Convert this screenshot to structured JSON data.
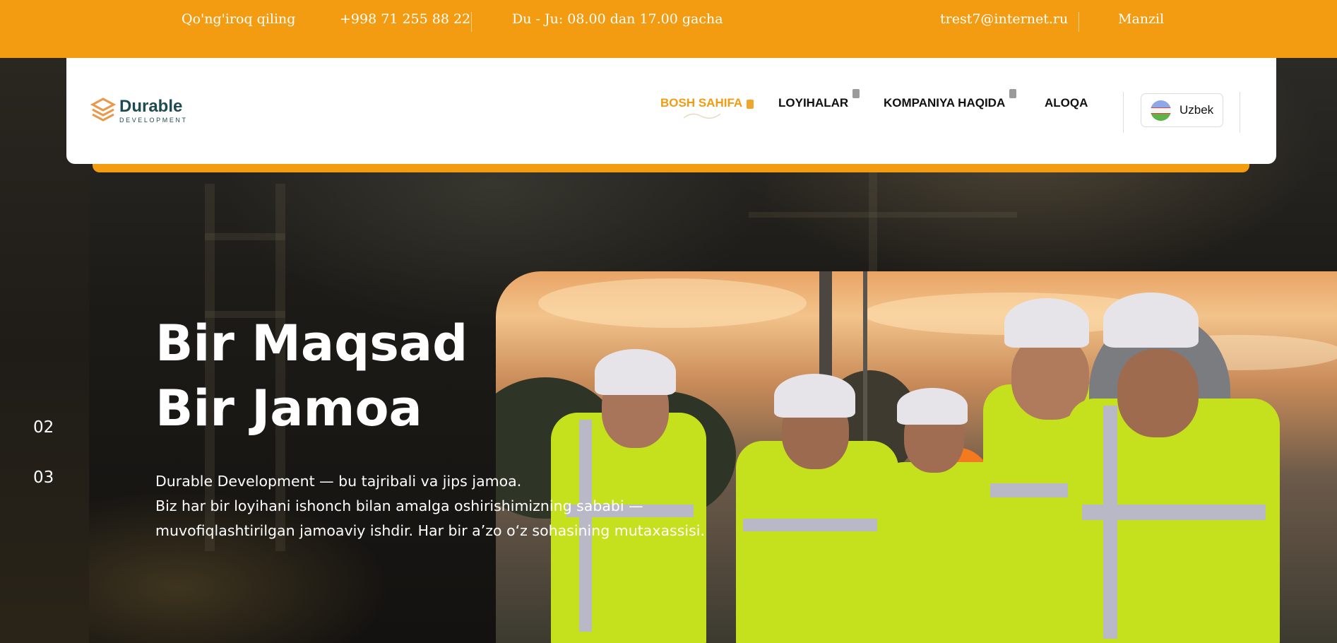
{
  "topbar": {
    "call_label": "Qo'ng'iroq qiling",
    "phone": "+998 71 255 88 22",
    "hours": "Du - Ju: 08.00 dan 17.00 gacha",
    "email": "trest7@internet.ru",
    "address_label": "Manzil",
    "bg_color": "#f39c12"
  },
  "logo": {
    "name": "Durable",
    "tagline": "DEVELOPMENT",
    "icon": "layers-logo-icon"
  },
  "nav": {
    "items": [
      {
        "label": "BOSH SAHIFA",
        "active": true
      },
      {
        "label": "LOYIHALAR",
        "active": false
      },
      {
        "label": "KOMPANIYA HAQIDA",
        "active": false
      },
      {
        "label": "ALOQA",
        "active": false
      }
    ],
    "accent_color": "#f39c12"
  },
  "language": {
    "selected": "Uzbek",
    "icon": "uzbek-flag-icon"
  },
  "hero": {
    "title_line1": "Bir Maqsad",
    "title_line2": "Bir Jamoa",
    "desc_line1": "Durable Development — bu tajribali va jips jamoa.",
    "desc_line2": "Biz har bir loyihani ishonch bilan amalga oshirishimizning sababi —",
    "desc_line3": "muvofiqlashtirilgan jamoaviy ishdir. Har bir a’zo o‘z sohasining mutaxassisi.",
    "slides": [
      "02",
      "03"
    ]
  }
}
